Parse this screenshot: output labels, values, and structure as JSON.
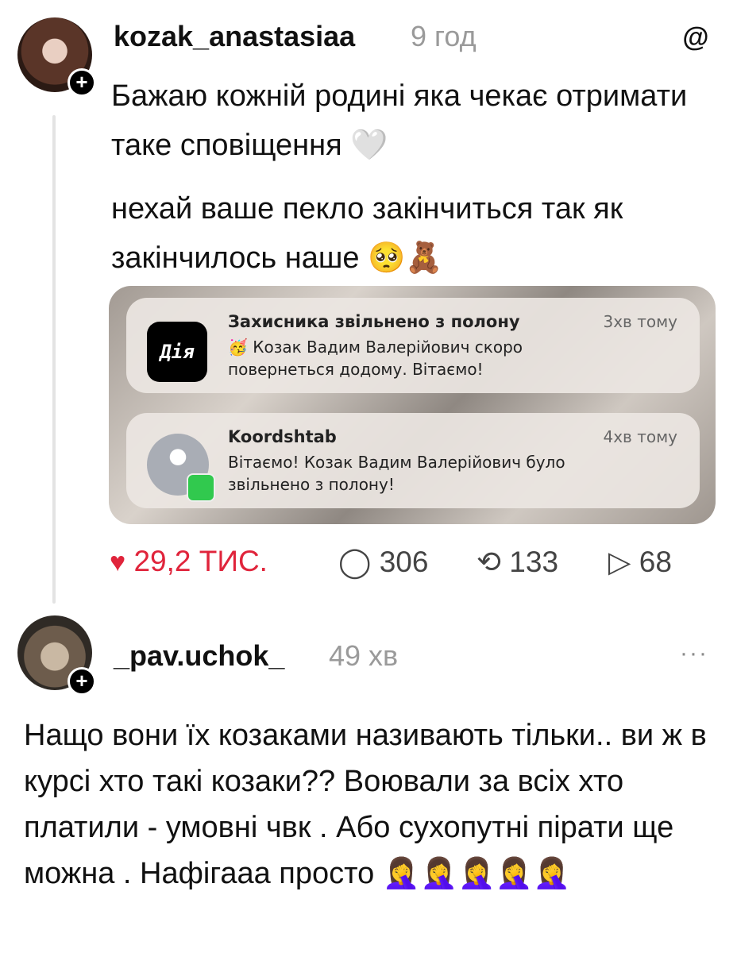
{
  "post1": {
    "username": "kozak_anastasiaa",
    "time": "9 год",
    "text_line1": "Бажаю кожній родині яка чекає отримати таке сповіщення 🤍",
    "text_line2": "нехай ваше пекло закінчиться так як закінчилось наше 🥺🧸",
    "image": {
      "notifications": [
        {
          "app_icon_label": "Дія",
          "title": "Захисника звільнено з полону",
          "time": "3хв тому",
          "body": "🥳 Козак Вадим Валерійович скоро повернеться додому. Вітаємо!"
        },
        {
          "title": "Koordshtab",
          "time": "4хв тому",
          "body": "Вітаємо! Козак Вадим Валерійович було звільнено з полону!"
        }
      ]
    },
    "actions": {
      "likes": "29,2 ТИС.",
      "comments": "306",
      "reposts": "133",
      "shares": "68"
    }
  },
  "post2": {
    "username": "_pav.uchok_",
    "time": "49 хв",
    "text": "Нащо вони їх козаками називають тільки.. ви ж в курсі хто такі козаки?? Воювали за всіх хто платили - умовні чвк . Або сухопутні пірати ще можна . Нафігааа просто 🤦‍♀️🤦‍♀️🤦‍♀️🤦‍♀️🤦‍♀️"
  },
  "icons": {
    "threads_logo": "@",
    "more": "···",
    "heart": "♥",
    "comment": "◯",
    "repost": "⟲",
    "share": "▷",
    "plus": "+"
  },
  "colors": {
    "like_active": "#e0243b",
    "muted": "#9a9a9a"
  }
}
